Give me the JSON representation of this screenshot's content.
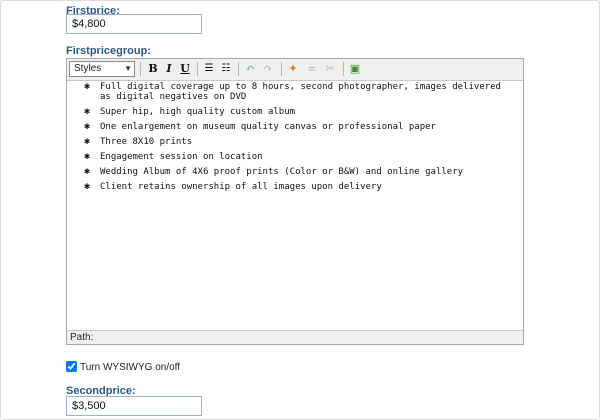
{
  "fields": {
    "firstprice": {
      "label": "Firstprice:",
      "value": "$4,800"
    },
    "firstpricegroup": {
      "label": "Firstpricegroup:"
    },
    "secondprice": {
      "label": "Secondprice:",
      "value": "$3,500"
    }
  },
  "editor": {
    "toolbar": {
      "styles_label": "Styles",
      "buttons": [
        {
          "name": "bold-icon",
          "glyph": "B"
        },
        {
          "name": "italic-icon",
          "glyph": "I"
        },
        {
          "name": "underline-icon",
          "glyph": "U"
        },
        {
          "name": "bullet-list-icon",
          "glyph": "☰"
        },
        {
          "name": "numbered-list-icon",
          "glyph": "☷"
        },
        {
          "name": "undo-icon",
          "glyph": "↶"
        },
        {
          "name": "redo-icon",
          "glyph": "↷"
        },
        {
          "name": "insert-image-icon",
          "glyph": "✦"
        },
        {
          "name": "link-icon",
          "glyph": "∞"
        },
        {
          "name": "unlink-icon",
          "glyph": "✂"
        },
        {
          "name": "html-source-icon",
          "glyph": "▣"
        }
      ]
    },
    "items": [
      {
        "line1": "Full digital coverage up to 8 hours, second photographer, images delivered",
        "line2": "as digital negatives on DVD"
      },
      {
        "line1": "Super hip, high quality custom album",
        "line2": ""
      },
      {
        "line1": "One enlargement on museum quality canvas or professional paper",
        "line2": ""
      },
      {
        "line1": "Three 8X10 prints",
        "line2": ""
      },
      {
        "line1": "Engagement session on location",
        "line2": ""
      },
      {
        "line1": "Wedding Album of 4X6 proof prints (Color or B&W) and online gallery",
        "line2": ""
      },
      {
        "line1": "Client retains ownership of all images upon delivery",
        "line2": ""
      }
    ],
    "bullet_glyph": "✱",
    "status_path_label": "Path:"
  },
  "wysiwyg": {
    "label": "Turn WYSIWYG on/off",
    "checked": true
  }
}
